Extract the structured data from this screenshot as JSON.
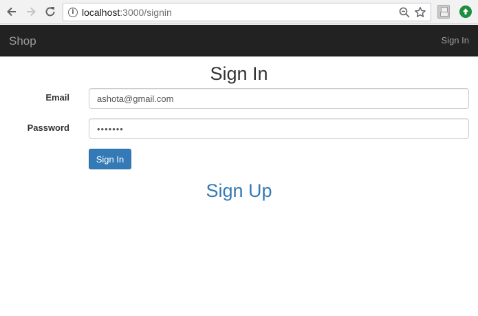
{
  "browser": {
    "url_host": "localhost",
    "url_path": ":3000/signin",
    "icons": [
      "back-arrow-icon",
      "forward-arrow-icon",
      "reload-icon",
      "info-icon",
      "zoom-icon",
      "star-icon",
      "extension-icon",
      "update-icon"
    ],
    "info_glyph": "i"
  },
  "navbar": {
    "brand": "Shop",
    "signin_link": "Sign In",
    "background": "#222222",
    "text_color": "#9d9d9d"
  },
  "form": {
    "title": "Sign In",
    "email_label": "Email",
    "email_value": "ashota@gmail.com",
    "password_label": "Password",
    "password_value": "•••••••",
    "submit_label": "Sign In",
    "submit_color": "#337ab7"
  },
  "signup": {
    "label": "Sign Up",
    "color": "#337ab7"
  }
}
